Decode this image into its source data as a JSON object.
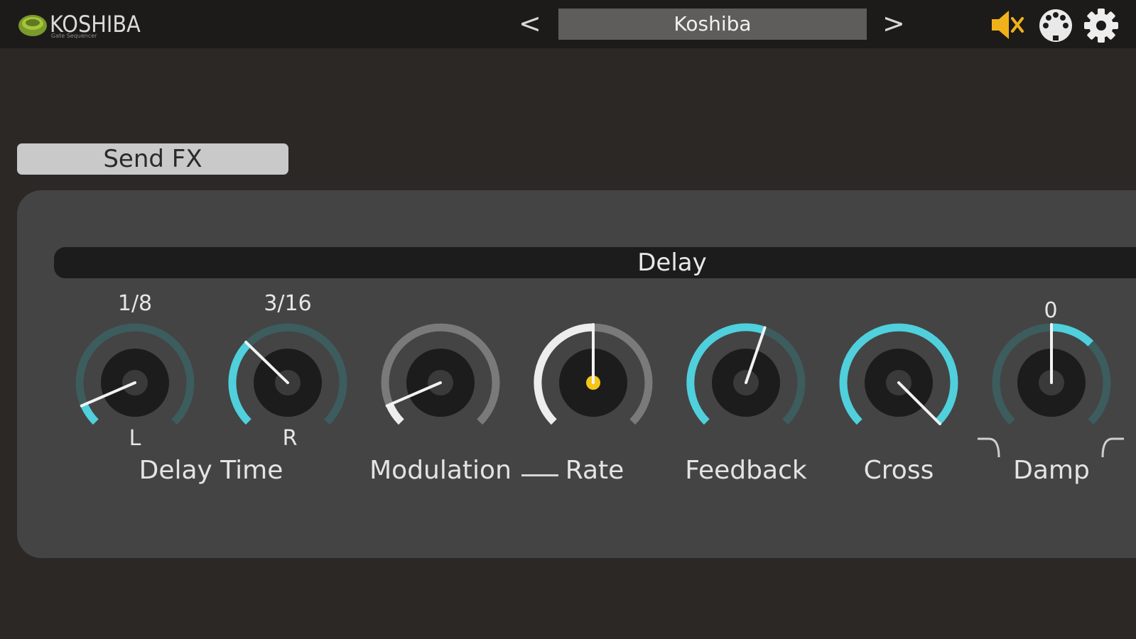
{
  "app": {
    "name": "KOSHIBA",
    "subtitle": "Gate Sequencer"
  },
  "header": {
    "prev_label": "<",
    "next_label": ">",
    "preset_name": "Koshiba",
    "icons": [
      "mute-icon",
      "midi-icon",
      "gear-icon"
    ]
  },
  "tab": {
    "label": "Send FX"
  },
  "section": {
    "title": "Delay",
    "knob_values": {
      "delay_left": "1/8",
      "delay_right": "3/16",
      "damp": "0"
    },
    "sub_labels": {
      "left": "L",
      "right": "R"
    },
    "labels": {
      "delay_time": "Delay Time",
      "modulation": "Modulation",
      "rate": "Rate",
      "feedback": "Feedback",
      "cross": "Cross",
      "damp": "Damp"
    },
    "knobs": [
      {
        "name": "delay-time-left-knob",
        "level": 0.08,
        "style": "cyan"
      },
      {
        "name": "delay-time-right-knob",
        "level": 0.33,
        "style": "cyan"
      },
      {
        "name": "modulation-knob",
        "level": 0.08,
        "style": "white"
      },
      {
        "name": "rate-knob",
        "level": 0.5,
        "style": "white-dot"
      },
      {
        "name": "feedback-knob",
        "level": 0.57,
        "style": "cyan"
      },
      {
        "name": "cross-knob",
        "level": 1.0,
        "style": "cyan-full"
      },
      {
        "name": "damp-knob",
        "level": 0.5,
        "style": "cyan-bipolar"
      }
    ]
  },
  "colors": {
    "accent": "#4fd0dc",
    "track": "#3d5c5e",
    "white_arc": "#ededed",
    "grey_track": "#7a7a7a",
    "dot": "#f5c518",
    "mute_icon": "#f0b21a"
  }
}
